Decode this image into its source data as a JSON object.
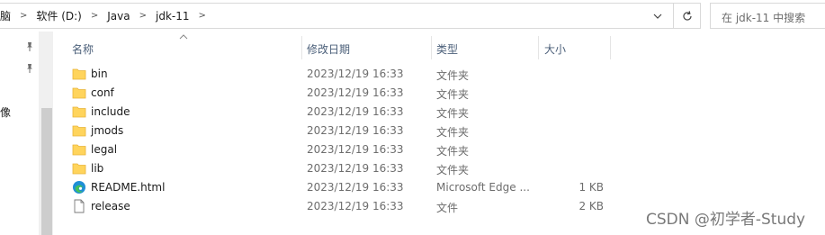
{
  "breadcrumb": {
    "items": [
      "脑",
      "软件 (D:)",
      "Java",
      "jdk-11"
    ]
  },
  "search": {
    "placeholder": "在 jdk-11 中搜索"
  },
  "nav": {
    "fragment_label": "像"
  },
  "columns": {
    "name": "名称",
    "date": "修改日期",
    "type": "类型",
    "size": "大小"
  },
  "files": [
    {
      "name": "bin",
      "date": "2023/12/19 16:33",
      "type": "文件夹",
      "size": "",
      "icon": "folder-icon"
    },
    {
      "name": "conf",
      "date": "2023/12/19 16:33",
      "type": "文件夹",
      "size": "",
      "icon": "folder-icon"
    },
    {
      "name": "include",
      "date": "2023/12/19 16:33",
      "type": "文件夹",
      "size": "",
      "icon": "folder-icon"
    },
    {
      "name": "jmods",
      "date": "2023/12/19 16:33",
      "type": "文件夹",
      "size": "",
      "icon": "folder-icon"
    },
    {
      "name": "legal",
      "date": "2023/12/19 16:33",
      "type": "文件夹",
      "size": "",
      "icon": "folder-icon"
    },
    {
      "name": "lib",
      "date": "2023/12/19 16:33",
      "type": "文件夹",
      "size": "",
      "icon": "folder-icon"
    },
    {
      "name": "README.html",
      "date": "2023/12/19 16:33",
      "type": "Microsoft Edge ...",
      "size": "1 KB",
      "icon": "edge-icon"
    },
    {
      "name": "release",
      "date": "2023/12/19 16:33",
      "type": "文件",
      "size": "2 KB",
      "icon": "file-icon"
    }
  ],
  "watermark": "CSDN @初学者-Study",
  "colors": {
    "folder": "#ffd45c",
    "folder_dark": "#e8b43a",
    "header_text": "#4c607a",
    "border": "#d9d9d9"
  }
}
